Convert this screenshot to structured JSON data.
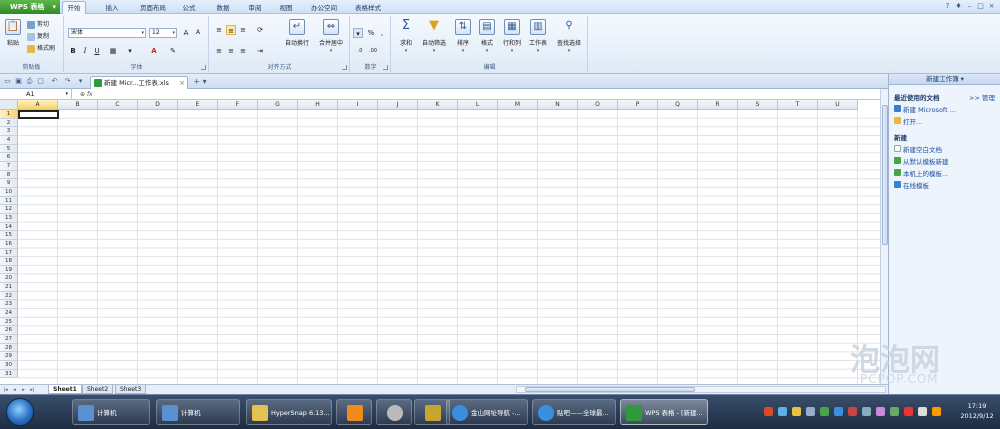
{
  "app_button": "WPS 表格",
  "menu_tabs": [
    "开始",
    "插入",
    "页面布局",
    "公式",
    "数据",
    "审阅",
    "视图",
    "办公空间",
    "表格样式"
  ],
  "ribbon": {
    "clipboard": {
      "paste": "粘贴",
      "cut": "剪切",
      "copy": "复制",
      "format_painter": "格式刷",
      "label": "剪贴板"
    },
    "font": {
      "name": "宋体",
      "size": "12",
      "label": "字体"
    },
    "alignment": {
      "wrap": "自动换行",
      "merge": "合并居中",
      "label": "对齐方式"
    },
    "number": {
      "label": "数字"
    },
    "edit": {
      "sum": "求和",
      "filter": "自动筛选",
      "sort": "排序",
      "format": "格式",
      "rowcol": "行和列",
      "sheet": "工作表",
      "find": "查找选择",
      "label": "编辑"
    }
  },
  "doc_tab": {
    "title": "新建 Micr...工作表.xls",
    "add": "+"
  },
  "name_box": "A1",
  "fx": "fx",
  "columns": [
    "A",
    "B",
    "C",
    "D",
    "E",
    "F",
    "G",
    "H",
    "I",
    "J",
    "K",
    "L",
    "M",
    "N",
    "O",
    "P",
    "Q",
    "R",
    "S",
    "T",
    "U"
  ],
  "rows": [
    "1",
    "2",
    "3",
    "4",
    "5",
    "6",
    "7",
    "8",
    "9",
    "10",
    "11",
    "12",
    "13",
    "14",
    "15",
    "16",
    "17",
    "18",
    "19",
    "20",
    "21",
    "22",
    "23",
    "24",
    "25",
    "26",
    "27",
    "28",
    "29",
    "30",
    "31"
  ],
  "sheets": [
    "Sheet1",
    "Sheet2",
    "Sheet3"
  ],
  "task_pane": {
    "title": "新建工作簿",
    "recent_header": "最近使用的文档",
    "manage": ">> 管理",
    "recent": [
      "新建 Microsoft ...",
      "打开..."
    ],
    "new_header": "新建",
    "new_items": [
      "新建空白文档",
      "从默认模板新建",
      "本机上的模板...",
      "在线模板"
    ]
  },
  "taskbar": {
    "items": [
      "计算机",
      "计算机",
      "HyperSnap 6.13...",
      "",
      "",
      "金山网址导航 -...",
      "贴吧——全球最...",
      "WPS 表格 - [新建..."
    ],
    "time": "17:19",
    "date": "2012/9/12"
  },
  "watermark": {
    "main": "泡泡网",
    "sub": "PCPOP.COM"
  },
  "colors": {
    "accent": "#2e8a23",
    "ribbon": "#dfeaf7",
    "selected_header": "#f7d36b"
  }
}
